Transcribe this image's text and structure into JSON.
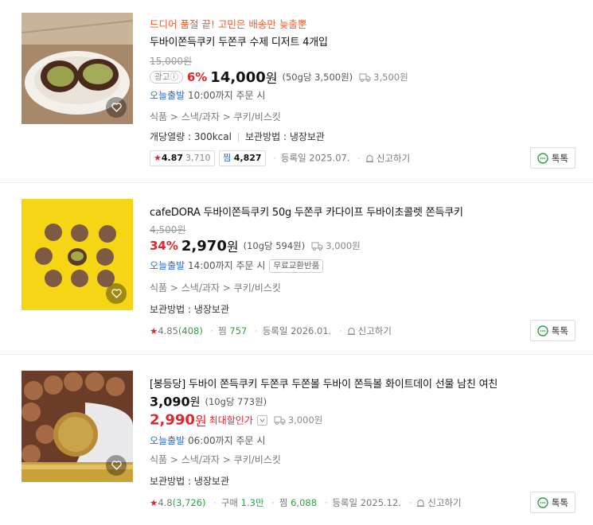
{
  "products": [
    {
      "promo": "드디어 품절 끝! 고민은 배송만 늦출뿐",
      "title": "두바이쫀득쿠키 두쫀쿠 수제 디저트 4개입",
      "original_price": "15,000원",
      "ad_badge": "광고ⓘ",
      "discount": "6%",
      "price": "14,000",
      "won": "원",
      "unit_price": "(50g당 3,500원)",
      "shipping": "3,500원",
      "today_label": "오늘출발",
      "cutoff": "10:00까지 주문 시",
      "category": "식품 > 스낵/과자 > 쿠키/비스킷",
      "spec1": "개당열량 : 300kcal",
      "spec2": "보관방법 : 냉장보관",
      "rating": "4.87",
      "review_count": "3,710",
      "zzim_label": "찜",
      "zzim_count": "4,827",
      "reg_date": "등록일 2025.07.",
      "report": "신고하기",
      "talk": "톡톡"
    },
    {
      "title": "cafeDORA 두바이쫀득쿠키 50g 두쫀쿠 카다이프 두바이초콜렛 쫀득쿠키",
      "original_price": "4,500원",
      "discount": "34%",
      "price": "2,970",
      "won": "원",
      "unit_price": "(10g당 594원)",
      "shipping": "3,000원",
      "today_label": "오늘출발",
      "cutoff": "14:00까지 주문 시",
      "free_return": "무료교환반품",
      "category": "식품 > 스낵/과자 > 쿠키/비스킷",
      "spec1": "보관방법 : 냉장보관",
      "rating": "4.85",
      "review_count": "(408)",
      "zzim_label": "찜",
      "zzim_count": "757",
      "reg_date": "등록일 2026.01.",
      "report": "신고하기",
      "talk": "톡톡"
    },
    {
      "title": "[봉등당] 두바이 쫀득쿠키 두쫀쿠 두쫀볼 두바이 쫀득볼 화이트데이 선물 남친 여친",
      "list_price": "3,090",
      "won": "원",
      "unit_price": "(10g당 773원)",
      "price": "2,990",
      "max_discount": "최대할인가",
      "shipping": "3,000원",
      "today_label": "오늘출발",
      "cutoff": "06:00까지 주문 시",
      "category": "식품 > 스낵/과자 > 쿠키/비스킷",
      "spec1": "보관방법 : 냉장보관",
      "rating": "4.8",
      "review_count": "(3,726)",
      "purchase_label": "구매",
      "purchase_count": "1.3만",
      "zzim_label": "찜",
      "zzim_count": "6,088",
      "reg_date": "등록일 2025.12.",
      "report": "신고하기",
      "talk": "톡톡"
    }
  ],
  "icons": {
    "heart": "heart-icon",
    "truck": "truck-icon",
    "star": "star-icon",
    "bell": "report-bell-icon",
    "talk": "chat-bubble-icon",
    "chevron": "chevron-down-icon"
  },
  "colors": {
    "promo": "#f05a28",
    "discount": "#e4252c",
    "today": "#2a6bd6",
    "review_green": "#2f9e44"
  }
}
